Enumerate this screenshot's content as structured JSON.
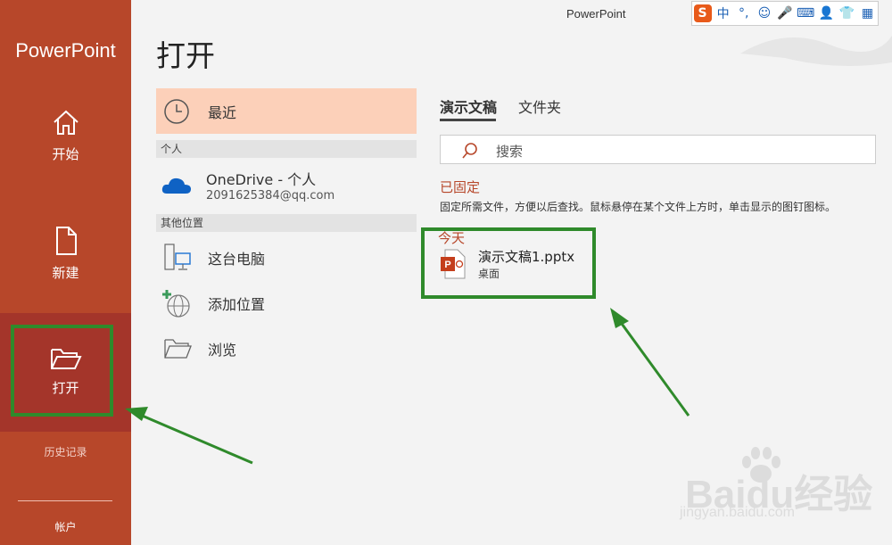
{
  "app": {
    "sidebar_title": "PowerPoint",
    "window_title": "PowerPoint"
  },
  "sidebar": {
    "items": [
      {
        "label": "开始",
        "icon": "home-icon"
      },
      {
        "label": "新建",
        "icon": "new-file-icon"
      },
      {
        "label": "打开",
        "icon": "open-folder-icon",
        "active": true
      }
    ],
    "history_label": "历史记录",
    "account_label": "帐户"
  },
  "ime_toolbar": {
    "items": [
      "S",
      "中",
      "°,",
      "☺",
      "🎤",
      "⌨",
      "👤",
      "👕",
      "▦"
    ]
  },
  "main": {
    "title": "打开",
    "locations": {
      "recent": "最近",
      "personal_header": "个人",
      "onedrive_name": "OneDrive - 个人",
      "onedrive_account": "2091625384@qq.com",
      "other_header": "其他位置",
      "this_pc": "这台电脑",
      "add_place": "添加位置",
      "browse": "浏览"
    },
    "tabs": [
      "演示文稿",
      "文件夹"
    ],
    "search_placeholder": "搜索",
    "pinned_heading": "已固定",
    "pinned_hint": "固定所需文件，方便以后查找。鼠标悬停在某个文件上方时，单击显示的图钉图标。",
    "today_heading": "今天",
    "file": {
      "name": "演示文稿1.pptx",
      "location": "桌面"
    }
  },
  "watermark": {
    "brand": "Baidu经验",
    "url": "jingyan.baidu.com"
  },
  "colors": {
    "accent": "#b7472a",
    "active_nav": "#a4352a",
    "recent_highlight": "#fcd0b9",
    "annotation_green": "#2f8a2b"
  }
}
